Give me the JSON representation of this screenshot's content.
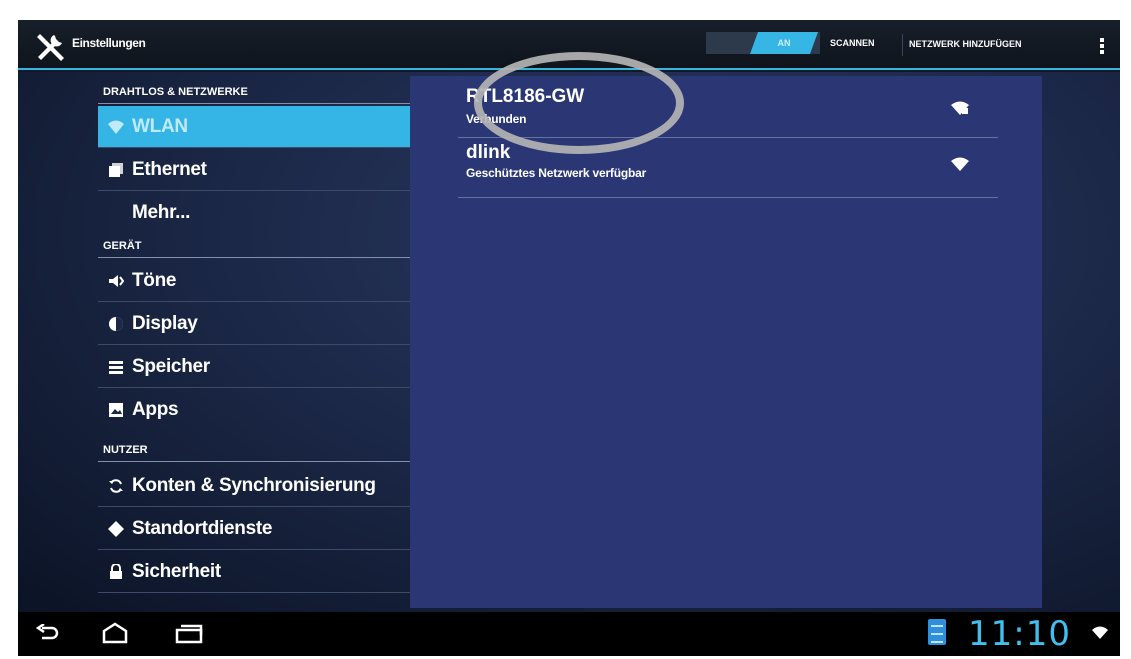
{
  "action_bar": {
    "title": "Einstellungen",
    "wifi_toggle_label": "AN",
    "scan_label": "SCANNEN",
    "add_network_label": "NETZWERK HINZUFÜGEN"
  },
  "nav": {
    "sections": [
      {
        "header": "DRAHTLOS & NETZWERKE"
      },
      {
        "header": "GERÄT"
      },
      {
        "header": "NUTZER"
      }
    ],
    "items": [
      {
        "label": "WLAN",
        "icon": "wifi-icon",
        "selected": true
      },
      {
        "label": "Ethernet",
        "icon": "ethernet-icon"
      },
      {
        "label": "Mehr...",
        "icon": ""
      },
      {
        "label": "Töne",
        "icon": "speaker-icon"
      },
      {
        "label": "Display",
        "icon": "display-icon"
      },
      {
        "label": "Speicher",
        "icon": "storage-icon"
      },
      {
        "label": "Apps",
        "icon": "apps-icon"
      },
      {
        "label": "Konten & Synchronisierung",
        "icon": "sync-icon"
      },
      {
        "label": "Standortdienste",
        "icon": "location-icon"
      },
      {
        "label": "Sicherheit",
        "icon": "lock-icon"
      }
    ]
  },
  "networks": [
    {
      "name": "RTL8186-GW",
      "status": "Verbunden",
      "secured": false
    },
    {
      "name": "dlink",
      "status": "Geschütztes Netzwerk verfügbar",
      "secured": true
    }
  ],
  "status_bar": {
    "clock": "11:10"
  },
  "colors": {
    "accent": "#35b5e5",
    "detail_bg": "#2b3775",
    "highlight_ring": "#b4b4b4"
  }
}
